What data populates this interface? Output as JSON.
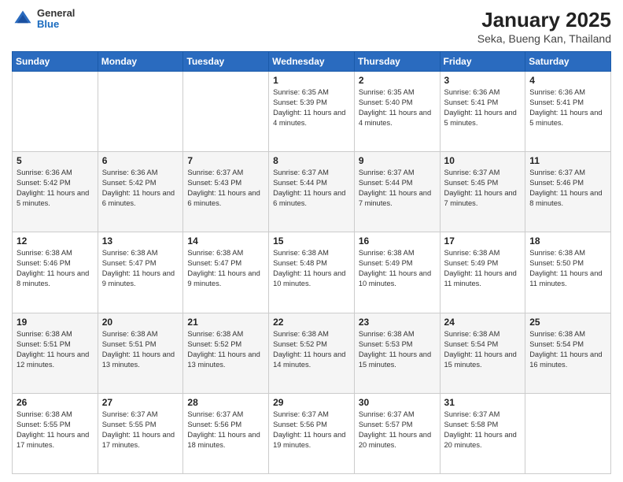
{
  "logo": {
    "general": "General",
    "blue": "Blue"
  },
  "header": {
    "title": "January 2025",
    "subtitle": "Seka, Bueng Kan, Thailand"
  },
  "weekdays": [
    "Sunday",
    "Monday",
    "Tuesday",
    "Wednesday",
    "Thursday",
    "Friday",
    "Saturday"
  ],
  "weeks": [
    [
      {
        "day": "",
        "data": ""
      },
      {
        "day": "",
        "data": ""
      },
      {
        "day": "",
        "data": ""
      },
      {
        "day": "1",
        "data": "Sunrise: 6:35 AM\nSunset: 5:39 PM\nDaylight: 11 hours and 4 minutes."
      },
      {
        "day": "2",
        "data": "Sunrise: 6:35 AM\nSunset: 5:40 PM\nDaylight: 11 hours and 4 minutes."
      },
      {
        "day": "3",
        "data": "Sunrise: 6:36 AM\nSunset: 5:41 PM\nDaylight: 11 hours and 5 minutes."
      },
      {
        "day": "4",
        "data": "Sunrise: 6:36 AM\nSunset: 5:41 PM\nDaylight: 11 hours and 5 minutes."
      }
    ],
    [
      {
        "day": "5",
        "data": "Sunrise: 6:36 AM\nSunset: 5:42 PM\nDaylight: 11 hours and 5 minutes."
      },
      {
        "day": "6",
        "data": "Sunrise: 6:36 AM\nSunset: 5:42 PM\nDaylight: 11 hours and 6 minutes."
      },
      {
        "day": "7",
        "data": "Sunrise: 6:37 AM\nSunset: 5:43 PM\nDaylight: 11 hours and 6 minutes."
      },
      {
        "day": "8",
        "data": "Sunrise: 6:37 AM\nSunset: 5:44 PM\nDaylight: 11 hours and 6 minutes."
      },
      {
        "day": "9",
        "data": "Sunrise: 6:37 AM\nSunset: 5:44 PM\nDaylight: 11 hours and 7 minutes."
      },
      {
        "day": "10",
        "data": "Sunrise: 6:37 AM\nSunset: 5:45 PM\nDaylight: 11 hours and 7 minutes."
      },
      {
        "day": "11",
        "data": "Sunrise: 6:37 AM\nSunset: 5:46 PM\nDaylight: 11 hours and 8 minutes."
      }
    ],
    [
      {
        "day": "12",
        "data": "Sunrise: 6:38 AM\nSunset: 5:46 PM\nDaylight: 11 hours and 8 minutes."
      },
      {
        "day": "13",
        "data": "Sunrise: 6:38 AM\nSunset: 5:47 PM\nDaylight: 11 hours and 9 minutes."
      },
      {
        "day": "14",
        "data": "Sunrise: 6:38 AM\nSunset: 5:47 PM\nDaylight: 11 hours and 9 minutes."
      },
      {
        "day": "15",
        "data": "Sunrise: 6:38 AM\nSunset: 5:48 PM\nDaylight: 11 hours and 10 minutes."
      },
      {
        "day": "16",
        "data": "Sunrise: 6:38 AM\nSunset: 5:49 PM\nDaylight: 11 hours and 10 minutes."
      },
      {
        "day": "17",
        "data": "Sunrise: 6:38 AM\nSunset: 5:49 PM\nDaylight: 11 hours and 11 minutes."
      },
      {
        "day": "18",
        "data": "Sunrise: 6:38 AM\nSunset: 5:50 PM\nDaylight: 11 hours and 11 minutes."
      }
    ],
    [
      {
        "day": "19",
        "data": "Sunrise: 6:38 AM\nSunset: 5:51 PM\nDaylight: 11 hours and 12 minutes."
      },
      {
        "day": "20",
        "data": "Sunrise: 6:38 AM\nSunset: 5:51 PM\nDaylight: 11 hours and 13 minutes."
      },
      {
        "day": "21",
        "data": "Sunrise: 6:38 AM\nSunset: 5:52 PM\nDaylight: 11 hours and 13 minutes."
      },
      {
        "day": "22",
        "data": "Sunrise: 6:38 AM\nSunset: 5:52 PM\nDaylight: 11 hours and 14 minutes."
      },
      {
        "day": "23",
        "data": "Sunrise: 6:38 AM\nSunset: 5:53 PM\nDaylight: 11 hours and 15 minutes."
      },
      {
        "day": "24",
        "data": "Sunrise: 6:38 AM\nSunset: 5:54 PM\nDaylight: 11 hours and 15 minutes."
      },
      {
        "day": "25",
        "data": "Sunrise: 6:38 AM\nSunset: 5:54 PM\nDaylight: 11 hours and 16 minutes."
      }
    ],
    [
      {
        "day": "26",
        "data": "Sunrise: 6:38 AM\nSunset: 5:55 PM\nDaylight: 11 hours and 17 minutes."
      },
      {
        "day": "27",
        "data": "Sunrise: 6:37 AM\nSunset: 5:55 PM\nDaylight: 11 hours and 17 minutes."
      },
      {
        "day": "28",
        "data": "Sunrise: 6:37 AM\nSunset: 5:56 PM\nDaylight: 11 hours and 18 minutes."
      },
      {
        "day": "29",
        "data": "Sunrise: 6:37 AM\nSunset: 5:56 PM\nDaylight: 11 hours and 19 minutes."
      },
      {
        "day": "30",
        "data": "Sunrise: 6:37 AM\nSunset: 5:57 PM\nDaylight: 11 hours and 20 minutes."
      },
      {
        "day": "31",
        "data": "Sunrise: 6:37 AM\nSunset: 5:58 PM\nDaylight: 11 hours and 20 minutes."
      },
      {
        "day": "",
        "data": ""
      }
    ]
  ]
}
